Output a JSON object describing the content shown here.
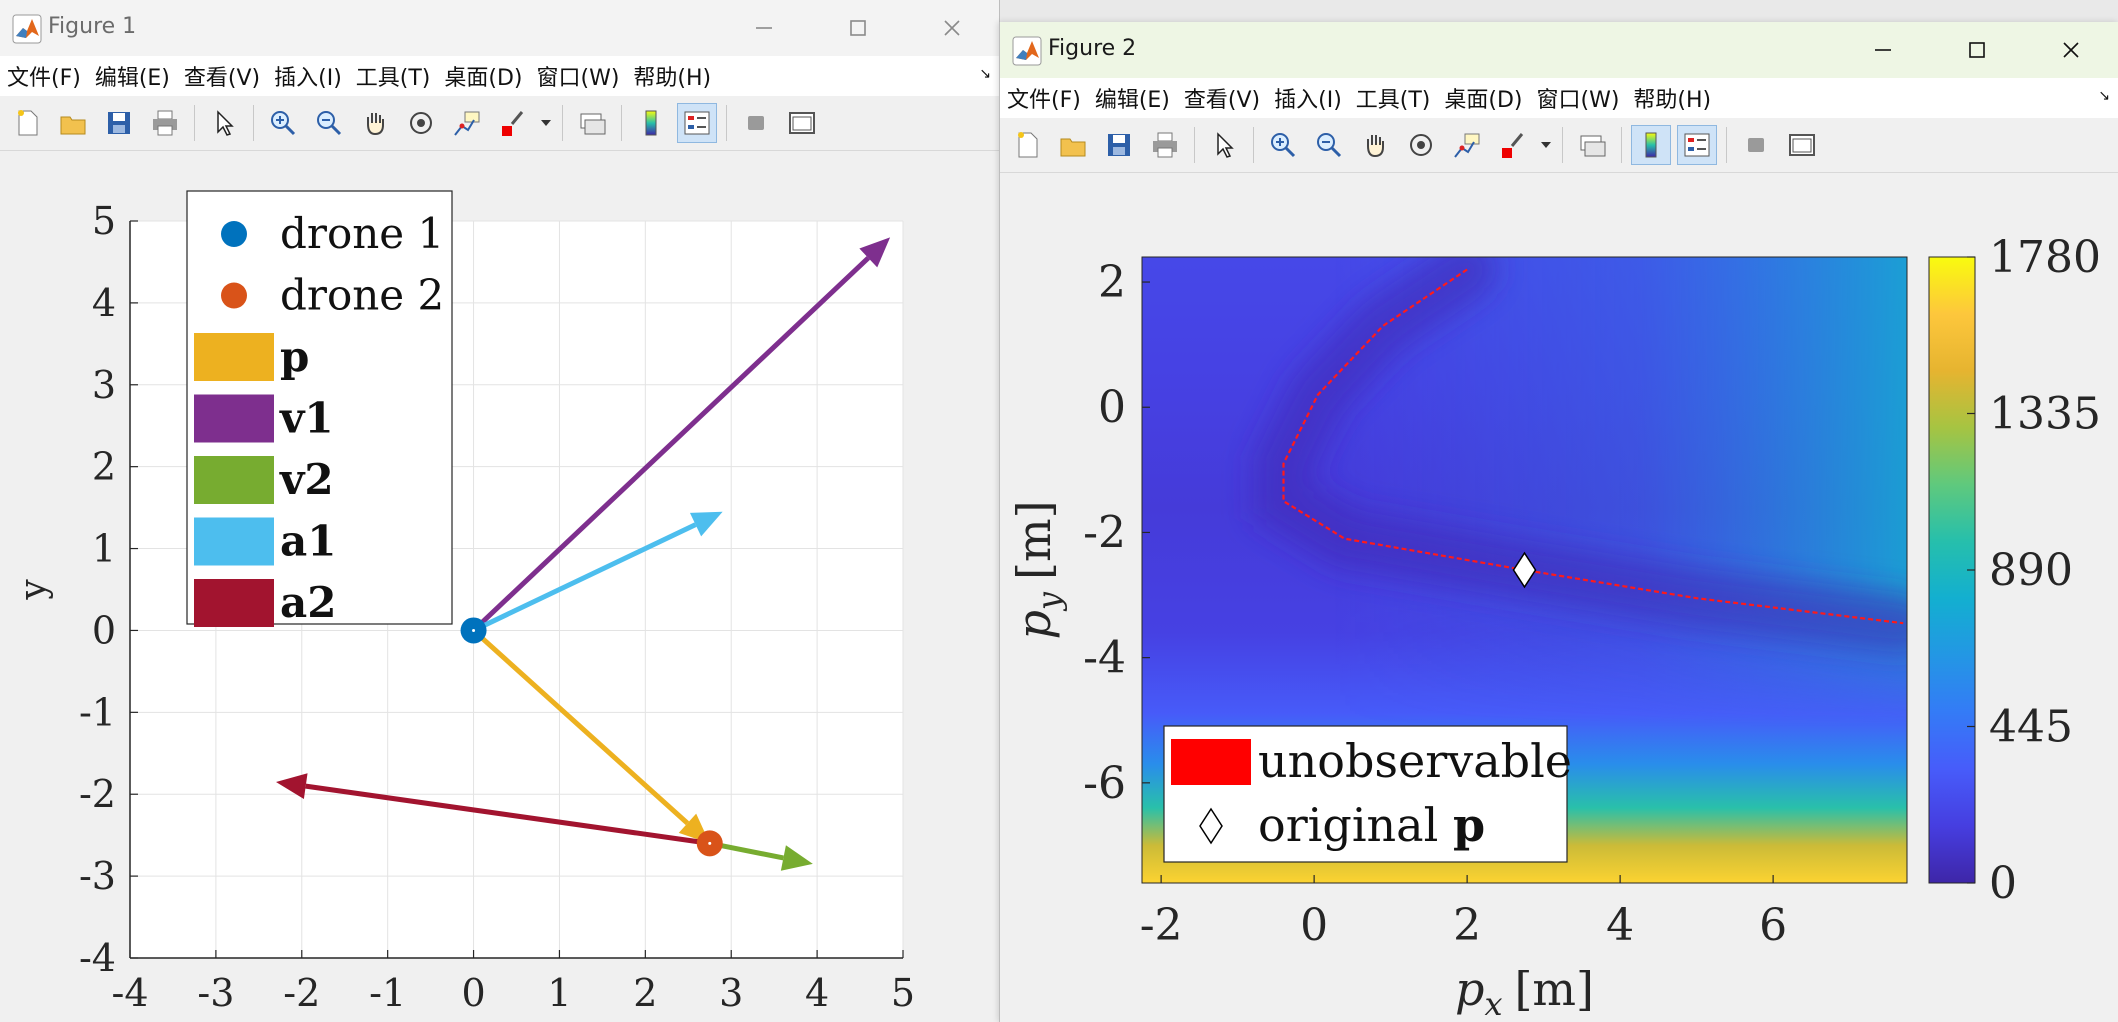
{
  "figure1": {
    "title": "Figure 1",
    "menus": [
      "文件(F)",
      "编辑(E)",
      "查看(V)",
      "插入(I)",
      "工具(T)",
      "桌面(D)",
      "窗口(W)",
      "帮助(H)"
    ],
    "toolbar": [
      "new-file",
      "open-file",
      "save",
      "print",
      "pointer",
      "zoom-in",
      "zoom-out",
      "pan",
      "rotate-3d",
      "data-cursor",
      "brush",
      "brush-dropdown",
      "link-plot",
      "colorbar",
      "legend",
      "hide-plot-tools",
      "show-plot-tools"
    ],
    "chart_data": {
      "type": "scatter",
      "ylabel": "y",
      "xlim": [
        -4,
        5
      ],
      "ylim": [
        -4,
        5
      ],
      "x_ticks": [
        "-4",
        "-3",
        "-2",
        "-1",
        "0",
        "1",
        "2",
        "3",
        "4",
        "5"
      ],
      "y_ticks": [
        "-4",
        "-3",
        "-2",
        "-1",
        "0",
        "1",
        "2",
        "3",
        "4",
        "5"
      ],
      "grid": true,
      "legend_position": "top-left",
      "points": [
        {
          "name": "drone 1",
          "x": 0,
          "y": 0,
          "color": "#0072BD"
        },
        {
          "name": "drone 2",
          "x": 2.75,
          "y": -2.6,
          "color": "#D95319"
        }
      ],
      "arrows": [
        {
          "name": "p",
          "x0": 0,
          "y0": 0,
          "x1": 2.75,
          "y1": -2.6,
          "color": "#EDB120"
        },
        {
          "name": "v1",
          "x0": 0,
          "y0": 0,
          "x1": 4.85,
          "y1": 4.8,
          "color": "#7E2F8E"
        },
        {
          "name": "v2",
          "x0": 2.75,
          "y0": -2.6,
          "x1": 3.95,
          "y1": -2.85,
          "color": "#77AC30"
        },
        {
          "name": "a1",
          "x0": 0,
          "y0": 0,
          "x1": 2.9,
          "y1": 1.45,
          "color": "#4DBEEE"
        },
        {
          "name": "a2",
          "x0": 2.75,
          "y0": -2.6,
          "x1": -2.3,
          "y1": -1.85,
          "color": "#A2142F"
        }
      ]
    }
  },
  "figure2": {
    "title": "Figure 2",
    "menus": [
      "文件(F)",
      "编辑(E)",
      "查看(V)",
      "插入(I)",
      "工具(T)",
      "桌面(D)",
      "窗口(W)",
      "帮助(H)"
    ],
    "toolbar": [
      "new-file",
      "open-file",
      "save",
      "print",
      "pointer",
      "zoom-in",
      "zoom-out",
      "pan",
      "rotate-3d",
      "data-cursor",
      "brush",
      "brush-dropdown",
      "link-plot",
      "colorbar",
      "legend",
      "hide-plot-tools",
      "show-plot-tools"
    ],
    "chart_data": {
      "type": "heatmap",
      "xlabel": "p_x [m]",
      "ylabel": "p_y [m]",
      "xlim": [
        -2.25,
        7.75
      ],
      "ylim": [
        -7.6,
        2.4
      ],
      "x_ticks": [
        "-2",
        "0",
        "2",
        "4",
        "6"
      ],
      "y_ticks": [
        "2",
        "0",
        "-2",
        "-4",
        "-6"
      ],
      "colorbar_range": [
        0,
        1780
      ],
      "colorbar_ticks": [
        "1780",
        "1335",
        "890",
        "445",
        "0"
      ],
      "legend_position": "bottom-left",
      "legend": [
        {
          "label": "unobservable",
          "color": "#FF0000"
        },
        {
          "label": "original p",
          "marker": "diamond"
        }
      ],
      "original_p": {
        "x": 2.75,
        "y": -2.6
      },
      "unobservable_curve": [
        {
          "x": 2.0,
          "y": 2.2
        },
        {
          "x": 0.9,
          "y": 1.3
        },
        {
          "x": 0.05,
          "y": 0.2
        },
        {
          "x": -0.4,
          "y": -0.9
        },
        {
          "x": -0.4,
          "y": -1.5
        },
        {
          "x": 0.4,
          "y": -2.1
        },
        {
          "x": 2.75,
          "y": -2.6
        },
        {
          "x": 5.0,
          "y": -3.05
        },
        {
          "x": 7.7,
          "y": -3.45
        }
      ]
    }
  }
}
